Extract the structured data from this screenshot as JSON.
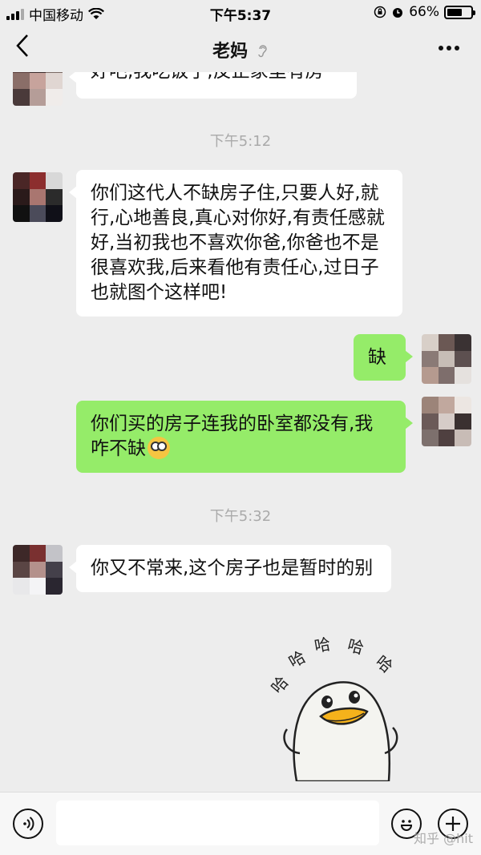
{
  "status_bar": {
    "carrier": "中国移动",
    "time": "下午5:37",
    "battery": "66%",
    "battery_level": 0.66
  },
  "nav": {
    "title": "老妈"
  },
  "messages": {
    "m0": "好吧,我吃饭了,反正家里有房",
    "ts1": "下午5:12",
    "m1": "你们这代人不缺房子住,只要人好,就行,心地善良,真心对你好,有责任感就好,当初我也不喜欢你爸,你爸也不是很喜欢我,后来看他有责任心,过日子也就图个这样吧!",
    "m2": "缺",
    "m3": "你们买的房子连我的卧室都没有,我咋不缺",
    "ts2": "下午5:32",
    "m4": "你又不常来,这个房子也是暂时的别",
    "sticker_text": "哈哈哈哈哈"
  },
  "watermark": "知乎 @hit",
  "colors": {
    "background": "#ededed",
    "sent_bubble": "#95ec69",
    "received_bubble": "#ffffff"
  }
}
